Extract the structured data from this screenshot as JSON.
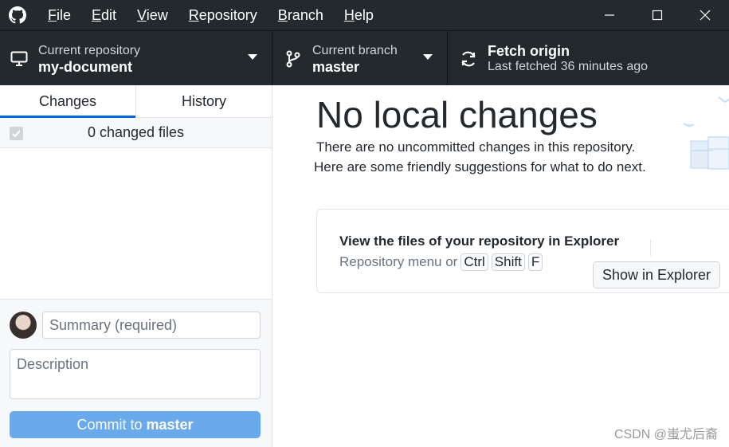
{
  "menu": {
    "items": [
      {
        "u": "F",
        "rest": "ile"
      },
      {
        "u": "E",
        "rest": "dit"
      },
      {
        "u": "V",
        "rest": "iew"
      },
      {
        "u": "R",
        "rest": "epository"
      },
      {
        "u": "B",
        "rest": "ranch"
      },
      {
        "u": "H",
        "rest": "elp"
      }
    ]
  },
  "toolbar": {
    "repo_label": "Current repository",
    "repo_name": "my-document",
    "branch_label": "Current branch",
    "branch_name": "master",
    "fetch_title": "Fetch origin",
    "fetch_sub": "Last fetched 36 minutes ago"
  },
  "sidebar": {
    "tabs": [
      {
        "label": "Changes"
      },
      {
        "label": "History"
      }
    ],
    "changed_files": "0 changed files",
    "summary_placeholder": "Summary (required)",
    "description_placeholder": "Description",
    "commit_prefix": "Commit to",
    "commit_branch": "master"
  },
  "main": {
    "title": "No local changes",
    "line1": "There are no uncommitted changes in this repository.",
    "line2": "Here are some friendly  suggestions for what to do next.",
    "card_title": "View the files of your repository in Explorer",
    "card_sub_prefix": "Repository menu or",
    "keys": [
      "Ctrl",
      "Shift",
      "F"
    ],
    "explorer_button": "Show in Explorer"
  },
  "watermark": "CSDN @蚩尤后裔",
  "colors": {
    "titlebar_bg": "#24292e",
    "accent": "#0366d6",
    "commit_button": "#6aa9ea"
  },
  "icons": [
    "github-logo-icon",
    "minimize-icon",
    "maximize-icon",
    "close-icon",
    "monitor-icon",
    "branch-icon",
    "sync-icon",
    "chevron-down-icon",
    "checkbox-icon"
  ]
}
